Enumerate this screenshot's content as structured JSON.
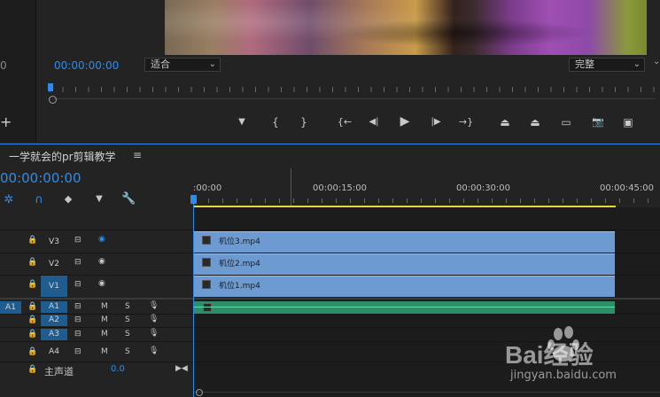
{
  "program_monitor": {
    "left_timecode_fragment": "0",
    "timecode": "00:00:00:00",
    "fit_dropdown": "适合",
    "quality_dropdown": "完整"
  },
  "controls": {
    "marker": "▼",
    "mark_in": "{",
    "mark_out": "}",
    "go_in": "{←",
    "step_back": "◀|",
    "play": "▶",
    "step_forward": "|▶",
    "go_out": "→}",
    "lift": "⏏",
    "extract": "⏏",
    "compare": "▭",
    "camera": "📷",
    "multi": "▣",
    "add": "+"
  },
  "timeline": {
    "sequence_tab": "一学就会的pr剪辑教学",
    "menu_icon": "≡",
    "timecode": "00:00:00:00",
    "ruler_labels": [
      ":00:00",
      "00:00:15:00",
      "00:00:30:00",
      "00:00:45:00"
    ],
    "tools": {
      "snap": "✲",
      "linked": "∩",
      "insert": "◆",
      "marker": "▼",
      "wrench": "🔧"
    },
    "video_tracks": [
      {
        "name": "V3",
        "clip": "机位3.mp4"
      },
      {
        "name": "V2",
        "clip": "机位2.mp4"
      },
      {
        "name": "V1",
        "clip": "机位1.mp4"
      }
    ],
    "audio_tracks": [
      {
        "source": "A1",
        "name": "A1",
        "mute": "M",
        "solo": "S"
      },
      {
        "name": "A2",
        "mute": "M",
        "solo": "S"
      },
      {
        "name": "A3",
        "mute": "M",
        "solo": "S"
      },
      {
        "name": "A4",
        "mute": "M",
        "solo": "S"
      }
    ],
    "master": {
      "label": "主声道",
      "value": "0.0",
      "end_icon": "▶◀"
    }
  },
  "watermark": {
    "brand": "Bai经验",
    "url": "jingyan.baidu.com"
  }
}
